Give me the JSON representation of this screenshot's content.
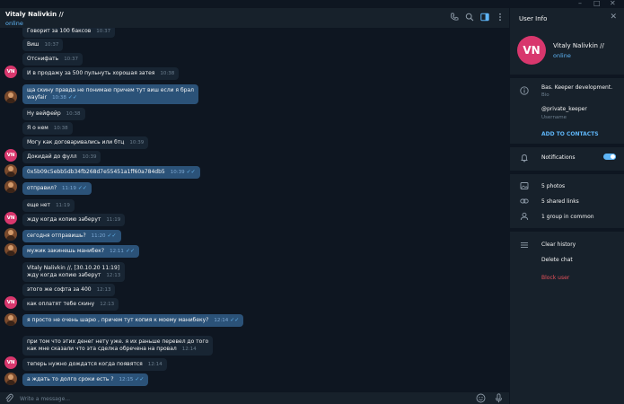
{
  "window": {
    "controls": [
      "–",
      "□",
      "✕"
    ]
  },
  "header": {
    "peer_name": "Vitaly Nalivkin //",
    "status": "online"
  },
  "avatars": {
    "peer_initials": "VN"
  },
  "messages": [
    {
      "dir": "in",
      "avatar": "",
      "text": "Говорит за 100 баксов",
      "time": "10:37"
    },
    {
      "dir": "in",
      "avatar": "",
      "text": "Виш",
      "time": "10:37"
    },
    {
      "dir": "in",
      "avatar": "",
      "text": "Отснифать",
      "time": "10:37"
    },
    {
      "dir": "in",
      "avatar": "vn",
      "text": "И в продажу за 500 пульнуть хорошая затея",
      "time": "10:38"
    },
    {
      "dir": "out",
      "avatar": "me",
      "text": "ща скину правда не понимаю причем тут виш если я брал\nwayfair",
      "time": "10:38"
    },
    {
      "dir": "in",
      "avatar": "",
      "text": "Ну вейфейр",
      "time": "10:38"
    },
    {
      "dir": "in",
      "avatar": "",
      "text": "Я о нем",
      "time": "10:38"
    },
    {
      "dir": "in",
      "avatar": "",
      "text": "Могу как договаривались или бтц",
      "time": "10:39"
    },
    {
      "dir": "in",
      "avatar": "vn",
      "text": "Докидай до фулл",
      "time": "10:39"
    },
    {
      "dir": "out",
      "avatar": "me",
      "text": "0x5b09c5ebb5db34fb268d7e55451a1ff60a784db5",
      "time": "10:39"
    },
    {
      "dir": "out",
      "avatar": "me",
      "text": "отправил?",
      "time": "11:19"
    },
    {
      "dir": "in",
      "avatar": "",
      "text": "еще нет",
      "time": "11:19"
    },
    {
      "dir": "in",
      "avatar": "vn",
      "text": "жду когда копию заберут",
      "time": "11:19"
    },
    {
      "dir": "out",
      "avatar": "me",
      "text": "сегодня отправишь?",
      "time": "11:20"
    },
    {
      "dir": "out",
      "avatar": "me",
      "text": "мужик закинешь манибек?",
      "time": "12:11"
    },
    {
      "dir": "in",
      "avatar": "",
      "text": "Vitaly Nalivkin //, [30.10.20 11:19]\nжду когда копию заберут",
      "time": "12:13"
    },
    {
      "dir": "in",
      "avatar": "",
      "text": "этого же софта за 400",
      "time": "12:13"
    },
    {
      "dir": "in",
      "avatar": "vn",
      "text": "как оплатят тебе скину",
      "time": "12:13"
    },
    {
      "dir": "out",
      "avatar": "me",
      "text": "я просто не очень шарю , причем тут копия к моему манибеку?",
      "time": "12:14"
    },
    {
      "dir": "in",
      "avatar": "",
      "text": "при том что этих денег нету уже. я их раньше перевел до того\nкак мне сказали что эта сделка обречена на провал",
      "time": "12:14"
    },
    {
      "dir": "in",
      "avatar": "vn",
      "text": "теперь нужно дождатся когда появятся",
      "time": "12:14"
    },
    {
      "dir": "out",
      "avatar": "me",
      "text": "а ждать то долго сроки есть ?",
      "time": "12:15"
    }
  ],
  "composer": {
    "placeholder": "Write a message..."
  },
  "info": {
    "title": "User Info",
    "initials": "VN",
    "name": "Vitaly Nalivkin //",
    "status": "online",
    "bio": "Bas. Keeper development.",
    "bio_label": "Bio",
    "username": "@private_keeper",
    "username_label": "Username",
    "add_contacts": "ADD TO CONTACTS",
    "notifications": "Notifications",
    "notifications_on": true,
    "photos": "5 photos",
    "links": "5 shared links",
    "groups": "1 group in common",
    "clear_history": "Clear history",
    "delete_chat": "Delete chat",
    "block_user": "Block user"
  },
  "colors": {
    "accent": "#5eb5f7",
    "avatar": "#d8376d",
    "danger": "#e8515b",
    "out_bubble": "#2b5278",
    "in_bubble": "#182533"
  }
}
